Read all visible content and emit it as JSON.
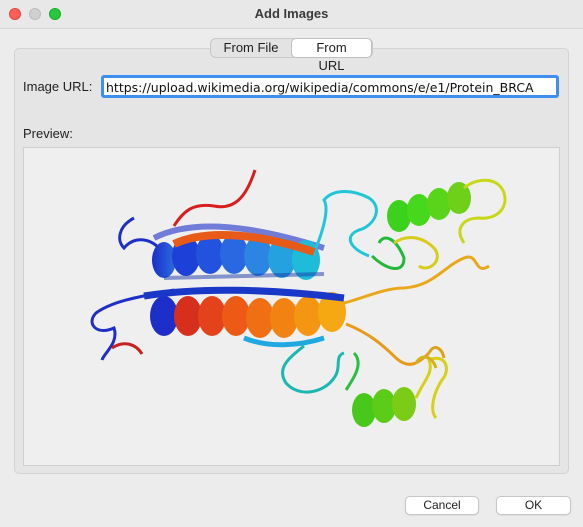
{
  "window": {
    "title": "Add Images"
  },
  "tabs": [
    {
      "label": "From File",
      "selected": false
    },
    {
      "label": "From URL",
      "selected": true
    }
  ],
  "form": {
    "url_label": "Image URL:",
    "url_value": "https://upload.wikimedia.org/wikipedia/commons/e/e1/Protein_BRCA",
    "preview_label": "Preview:"
  },
  "preview": {
    "icon": "protein-ribbon-image"
  },
  "buttons": {
    "cancel": "Cancel",
    "ok": "OK"
  },
  "colors": {
    "close": "#ff5f57",
    "minimize": "#d0d0d0",
    "maximize": "#28c840",
    "focus_ring": "#3d8ff0"
  }
}
